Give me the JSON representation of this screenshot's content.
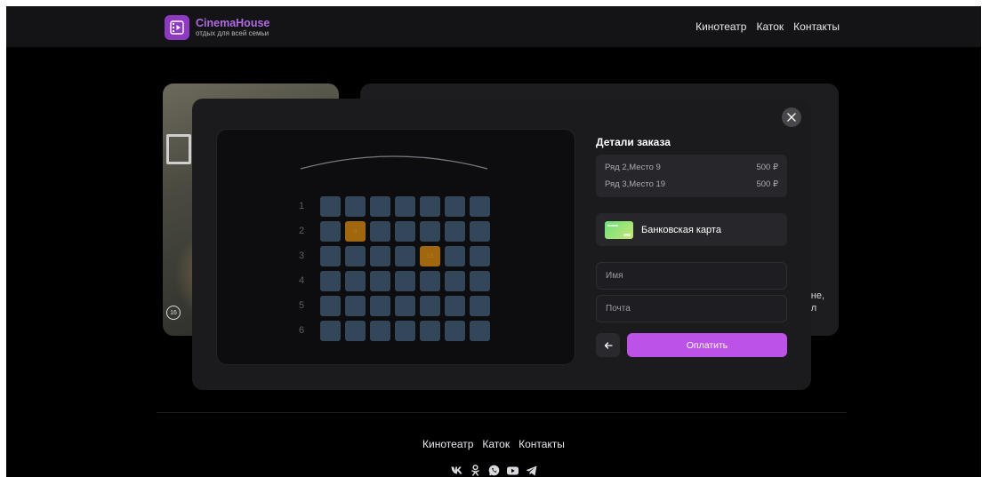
{
  "header": {
    "brand": "CinemaHouse",
    "tagline": "отдых для всей семьи",
    "nav": [
      "Кинотеатр",
      "Каток",
      "Контакты"
    ]
  },
  "background": {
    "info_peek_lines": [
      "не,",
      "л"
    ],
    "poster_age": "16"
  },
  "modal": {
    "details_title": "Детали заказа",
    "order": [
      {
        "label": "Ряд 2,Место 9",
        "price": "500 ₽"
      },
      {
        "label": "Ряд 3,Место 19",
        "price": "500 ₽"
      }
    ],
    "payment_method": "Банковская карта",
    "name_placeholder": "Имя",
    "email_placeholder": "Почта",
    "pay_button": "Оплатить",
    "rows": [
      "1",
      "2",
      "3",
      "4",
      "5",
      "6"
    ],
    "seats_per_row": 7,
    "selected_seats": [
      {
        "row": 2,
        "seat": 2,
        "label": "9"
      },
      {
        "row": 3,
        "seat": 5,
        "label": "19"
      }
    ]
  },
  "footer": {
    "nav": [
      "Кинотеатр",
      "Каток",
      "Контакты"
    ],
    "socials": [
      "vk-icon",
      "ok-icon",
      "whatsapp-icon",
      "youtube-icon",
      "telegram-icon"
    ]
  },
  "colors": {
    "accent": "#bd52e8",
    "brand": "#8e39c2",
    "seat": "#33465a",
    "seat_selected": "#a0670f"
  }
}
